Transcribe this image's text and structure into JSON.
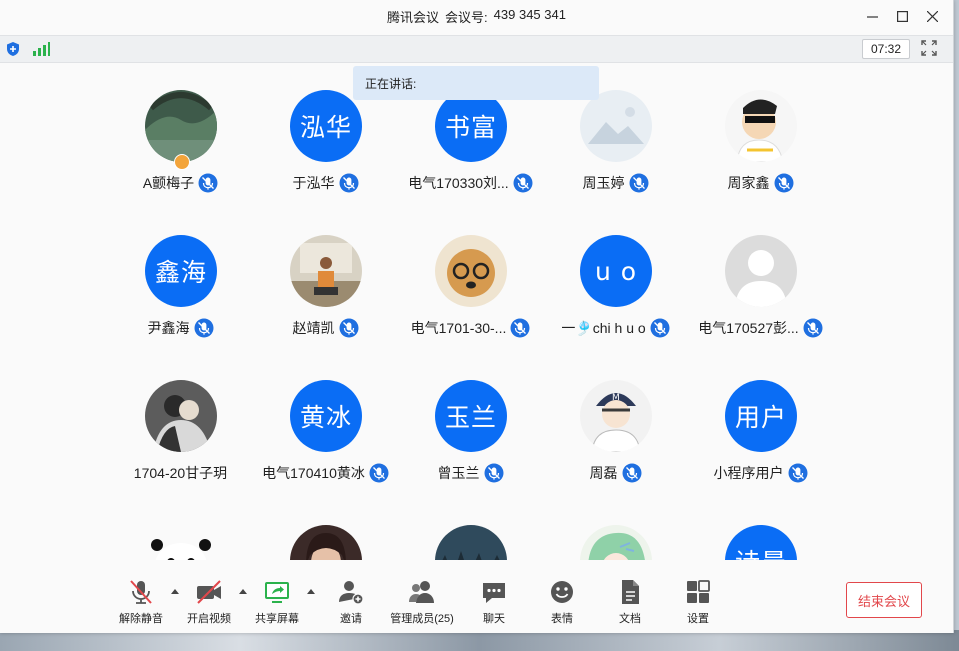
{
  "window": {
    "app_name": "腾讯会议",
    "meeting_label": "会议号:",
    "meeting_id": "439 345 341"
  },
  "toolstrip": {
    "timer": "07:32"
  },
  "speaking": {
    "label": "正在讲话:"
  },
  "participants": [
    {
      "name": "A颤梅子",
      "avatar": "photo",
      "icon": "forest-photo-avatar",
      "host": true
    },
    {
      "name": "于泓华",
      "avatar": "text",
      "initials": "泓华"
    },
    {
      "name": "电气170330刘...",
      "avatar": "text",
      "initials": "书富"
    },
    {
      "name": "周玉婷",
      "avatar": "photo",
      "icon": "image-unavailable-avatar"
    },
    {
      "name": "周家鑫",
      "avatar": "photo",
      "icon": "cartoon-sunglasses-avatar"
    },
    {
      "name": "尹鑫海",
      "avatar": "text",
      "initials": "鑫海"
    },
    {
      "name": "赵靖凯",
      "avatar": "photo",
      "icon": "person-sitting-avatar"
    },
    {
      "name": "电气1701-30-...",
      "avatar": "photo",
      "icon": "dog-glasses-avatar"
    },
    {
      "name": "一🎐chi h u ο",
      "avatar": "text",
      "initials": "u o"
    },
    {
      "name": "电气170527彭...",
      "avatar": "photo",
      "icon": "default-user-avatar"
    },
    {
      "name": "1704-20甘子玥",
      "avatar": "photo",
      "icon": "couple-photo-avatar",
      "no_mic": true
    },
    {
      "name": "电气170410黄冰",
      "avatar": "text",
      "initials": "黄冰"
    },
    {
      "name": "曾玉兰",
      "avatar": "text",
      "initials": "玉兰"
    },
    {
      "name": "周磊",
      "avatar": "photo",
      "icon": "anime-baseball-avatar"
    },
    {
      "name": "小程序用户",
      "avatar": "text",
      "initials": "用户"
    },
    {
      "name": "",
      "avatar": "photo",
      "icon": "panda-avatar",
      "partial": true
    },
    {
      "name": "",
      "avatar": "photo",
      "icon": "woman-photo-avatar",
      "partial": true
    },
    {
      "name": "",
      "avatar": "photo",
      "icon": "night-forest-avatar",
      "partial": true
    },
    {
      "name": "",
      "avatar": "photo",
      "icon": "anime-green-hair-avatar",
      "partial": true
    },
    {
      "name": "",
      "avatar": "text",
      "initials": "诗晨",
      "partial": true
    }
  ],
  "toolbar": {
    "unmute": "解除静音",
    "start_video": "开启视频",
    "share_screen": "共享屏幕",
    "invite": "邀请",
    "manage_members": "管理成员(25)",
    "chat": "聊天",
    "reactions": "表情",
    "docs": "文档",
    "settings": "设置",
    "end_meeting": "结束会议"
  },
  "colors": {
    "accent": "#0a6df5",
    "danger": "#e2474b",
    "green": "#2bb24c"
  }
}
